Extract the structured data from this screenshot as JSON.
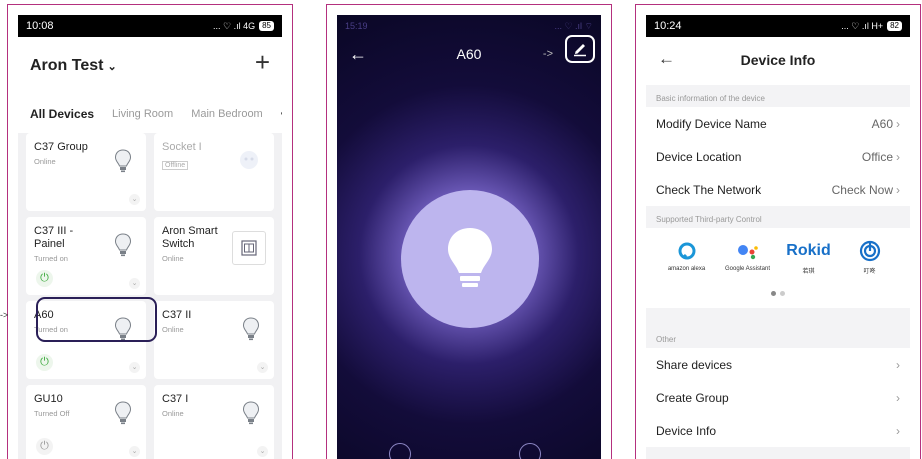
{
  "colors": {
    "frame": "#b4307e",
    "highlight": "#2a1f57",
    "power_on": "#38a838",
    "rokid": "#1870c8",
    "google_blue": "#4285F4",
    "alexa": "#1a96d8"
  },
  "home": {
    "status": {
      "time": "10:08",
      "signal": "... ♡ .ıl 4G",
      "battery": "85"
    },
    "title": "Aron Test",
    "add_icon": "plus-icon",
    "tabs": [
      "All Devices",
      "Living Room",
      "Main Bedroom"
    ],
    "more": "•••",
    "pointer": "->",
    "devices": [
      {
        "name": "C37 Group",
        "status": "Online",
        "icon": "bulb-icon",
        "dim": false
      },
      {
        "name": "Socket I",
        "status": "Offline",
        "icon": "socket-icon",
        "dim": true
      },
      {
        "name": "C37 III - Painel",
        "status": "Turned on",
        "icon": "bulb-icon",
        "power": "on"
      },
      {
        "name": "Aron Smart Switch",
        "status": "Online",
        "icon": "switch-icon"
      },
      {
        "name": "A60",
        "status": "Turned on",
        "icon": "bulb-icon",
        "power": "on"
      },
      {
        "name": "C37 II",
        "status": "Online",
        "icon": "bulb-icon"
      },
      {
        "name": "GU10",
        "status": "Turned Off",
        "icon": "bulb-icon",
        "power": "off"
      },
      {
        "name": "C37 I",
        "status": "Online",
        "icon": "bulb-icon"
      }
    ]
  },
  "lamp": {
    "status": {
      "time": "15:19",
      "signal": "... ♡ .ıl ⌔"
    },
    "title": "A60",
    "pointer": "->",
    "edit_icon": "pencil-icon"
  },
  "info": {
    "status": {
      "time": "10:24",
      "signal": "... ♡ .ıl H+",
      "battery": "82"
    },
    "title": "Device Info",
    "basic_section": "Basic information of the device",
    "rows_basic": [
      {
        "label": "Modify Device Name",
        "value": "A60"
      },
      {
        "label": "Device Location",
        "value": "Office"
      },
      {
        "label": "Check The Network",
        "value": "Check Now"
      }
    ],
    "third_party_section": "Supported Third-party Control",
    "third_party": [
      {
        "label": "amazon alexa",
        "icon": "alexa-icon"
      },
      {
        "label": "Google Assistant",
        "icon": "google-assistant-icon"
      },
      {
        "label": "若琪",
        "logo": "Rokid"
      },
      {
        "label": "叮咚",
        "icon": "dingdong-icon"
      }
    ],
    "other_section": "Other",
    "rows_other": [
      {
        "label": "Share devices"
      },
      {
        "label": "Create Group"
      },
      {
        "label": "Device Info"
      }
    ]
  }
}
